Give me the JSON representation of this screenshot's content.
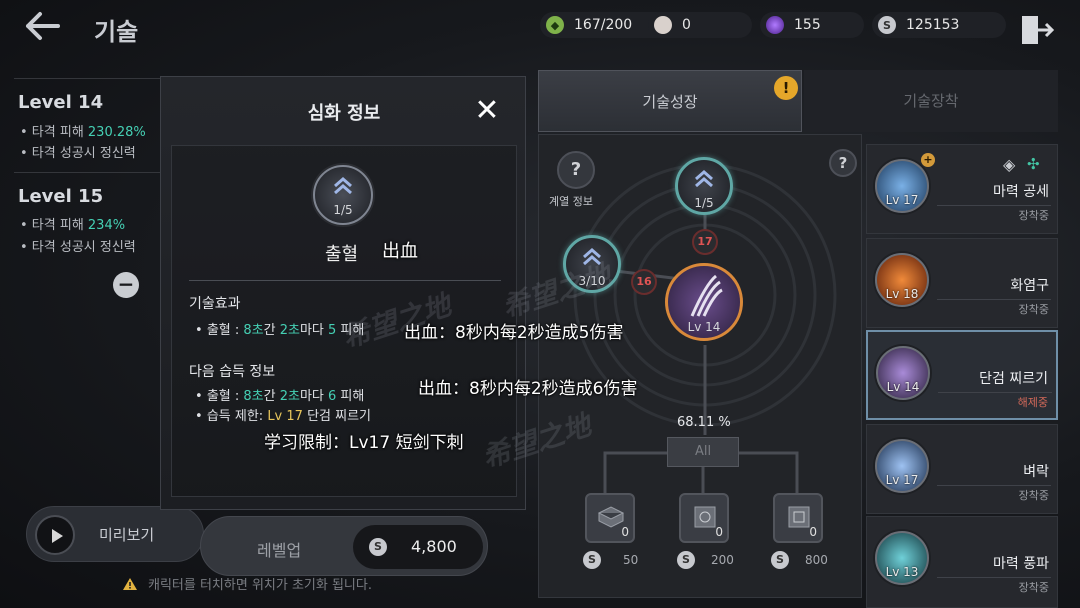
{
  "header": {
    "title": "기술",
    "resources": [
      {
        "icon": "green-gem-icon",
        "value": "167/200",
        "color": "#7fb24a"
      },
      {
        "icon": "pearl-icon",
        "value": "0",
        "color": "#d9d1cc"
      },
      {
        "icon": "purple-orb-icon",
        "value": "155",
        "color": "#7a3fc9"
      },
      {
        "icon": "silver-coin-icon",
        "value": "125153",
        "color": "#c7c9ce"
      }
    ]
  },
  "levels": [
    {
      "title": "Level 14",
      "lines": [
        {
          "prefix": "• 타격 피해 ",
          "value": "230.28%",
          "suffix": ""
        },
        {
          "prefix": "• 타격 성공시 정신력",
          "value": "",
          "suffix": ""
        }
      ]
    },
    {
      "title": "Level 15",
      "lines": [
        {
          "prefix": "• 타격 피해 ",
          "value": "234%",
          "suffix": ""
        },
        {
          "prefix": "• 타격 성공시 정신력",
          "value": "",
          "suffix": ""
        }
      ]
    }
  ],
  "preview": {
    "label": "미리보기"
  },
  "warning": {
    "text": "캐릭터를 터치하면 위치가 초기화 됩니다."
  },
  "modal": {
    "title": "심화 정보",
    "close": "✕",
    "skill_level": "1/5",
    "skill_name": "출혈",
    "skill_name_overlay": "出血",
    "effect": {
      "title": "기술효과",
      "bullet": {
        "b": "•",
        "label": "출혈 : ",
        "n1": "8초",
        "t1": "간 ",
        "n2": "2초",
        "t2": "마다 ",
        "n3": "5",
        "t3": " 피해"
      },
      "overlay": "出血：8秒内每2秒造成5伤害"
    },
    "next": {
      "title": "다음 습득 정보",
      "bullet1": {
        "b": "•",
        "label": "출혈 : ",
        "n1": "8초",
        "t1": "간 ",
        "n2": "2초",
        "t2": "마다 ",
        "n3": "6",
        "t3": " 피해"
      },
      "bullet2": {
        "b": "•",
        "label": "습득 제한: ",
        "lv": "Lv 17",
        "rest": " 단검 찌르기"
      },
      "overlay1": "出血：8秒内每2秒造成6伤害",
      "overlay2": "学习限制：Lv17 短剑下刺"
    }
  },
  "watermark": "希望之地",
  "level_up": {
    "label": "레벨업",
    "cost": "4,800",
    "coin": "S"
  },
  "tabs": [
    {
      "label": "기술성장",
      "active": true
    },
    {
      "label": "기술장착",
      "active": false
    }
  ],
  "tab_alert": "!",
  "tree": {
    "help": "?",
    "series_info": {
      "icon": "?",
      "label": "계열 정보"
    },
    "node_top": "1/5",
    "node_left": "3/10",
    "req_top": "17",
    "req_left": "16",
    "main_node": "Lv 14",
    "progress": "68.11 %",
    "all_button": "All",
    "slots": [
      {
        "count": "0",
        "cost": "50"
      },
      {
        "count": "0",
        "cost": "200"
      },
      {
        "count": "0",
        "cost": "800"
      }
    ]
  },
  "skills": [
    {
      "lv": "Lv 17",
      "name": "마력 공세",
      "status": "장착중",
      "color": "#3a6fa8"
    },
    {
      "lv": "Lv 18",
      "name": "화염구",
      "status": "장착중",
      "color": "#c4521f"
    },
    {
      "lv": "Lv 14",
      "name": "단검 찌르기",
      "status": "해제중",
      "color": "#6a4d8c"
    },
    {
      "lv": "Lv 17",
      "name": "벼락",
      "status": "장착중",
      "color": "#4a7fc2"
    },
    {
      "lv": "Lv 13",
      "name": "마력 풍파",
      "status": "장착중",
      "color": "#2f8f9a"
    }
  ]
}
